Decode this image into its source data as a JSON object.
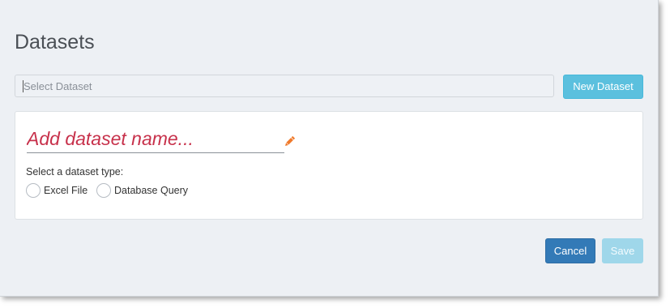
{
  "header": {
    "title": "Datasets"
  },
  "dataset_selector": {
    "placeholder": "Select Dataset",
    "new_button_label": "New Dataset"
  },
  "editor": {
    "name_placeholder": "Add dataset name...",
    "edit_icon": "pencil-icon",
    "type_prompt": "Select a dataset type:",
    "types": [
      {
        "label": "Excel File",
        "selected": false
      },
      {
        "label": "Database Query",
        "selected": false
      }
    ]
  },
  "footer": {
    "cancel_label": "Cancel",
    "save_label": "Save",
    "save_enabled": false
  },
  "colors": {
    "accent_name": "#c7314b",
    "pencil": "#f07a2c",
    "info_button": "#5bc0de",
    "primary_button": "#337ab7",
    "disabled_button": "#9fd7ea"
  }
}
